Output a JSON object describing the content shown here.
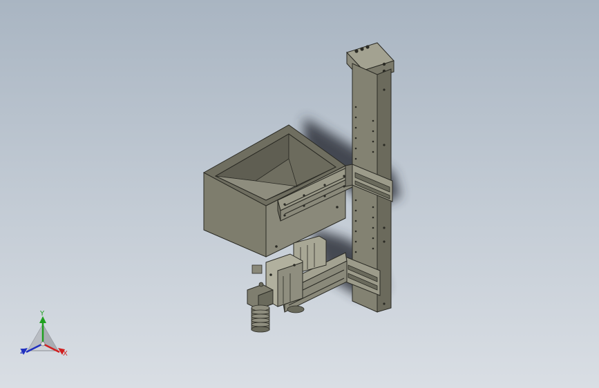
{
  "viewport": {
    "background_top": "#a9b5c2",
    "background_bottom": "#d9dee4"
  },
  "triad": {
    "y_label": "Y",
    "x_label": "X",
    "z_label": "Z",
    "y_color": "#1fa01f",
    "x_color": "#d02020",
    "z_color": "#2030c0"
  },
  "model": {
    "body_color": "#7d7c6c",
    "shadow_color": "#3a3d44"
  }
}
